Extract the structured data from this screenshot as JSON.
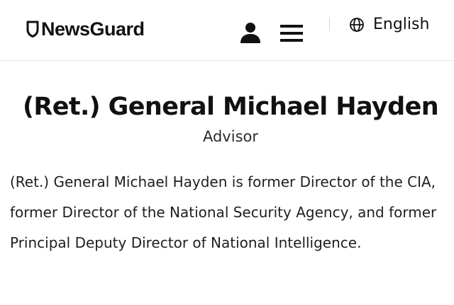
{
  "header": {
    "logo_text": "NewsGuard",
    "logo_icon": "shield-icon",
    "user_icon": "user-icon",
    "menu_icon": "hamburger-menu-icon",
    "language_icon": "globe-icon",
    "language_label": "English"
  },
  "profile": {
    "name": "(Ret.) General Michael Hayden",
    "role": "Advisor",
    "bio": "(Ret.) General Michael Hayden is former Director of the CIA, former Director of the National Security Agency, and former Principal Deputy Director of National Intelligence."
  },
  "colors": {
    "text": "#111111",
    "background": "#ffffff",
    "divider": "#e4e4e4"
  }
}
